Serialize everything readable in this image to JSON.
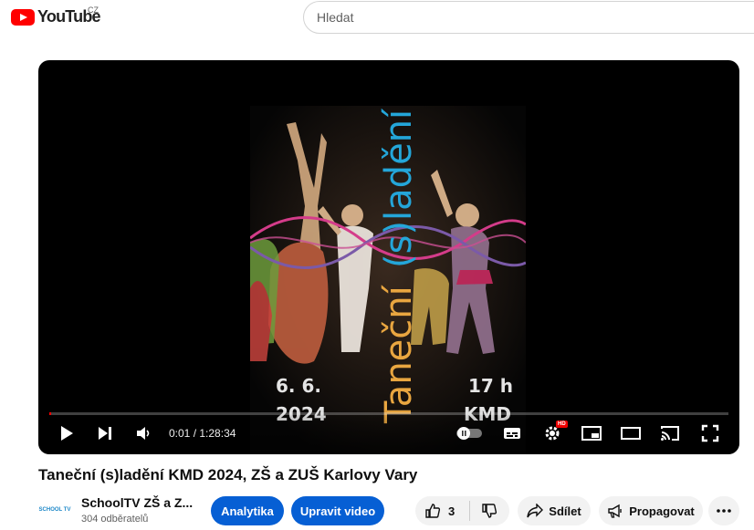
{
  "header": {
    "logo_text": "YouTube",
    "country_code": "CZ",
    "search_placeholder": "Hledat"
  },
  "poster": {
    "title_part1": "Taneční",
    "title_part2": "(s)ladění",
    "date_day": "6. 6.",
    "date_year": "2024",
    "time": "17 h",
    "venue": "KMD"
  },
  "player": {
    "current_time": "0:01",
    "separator": " / ",
    "duration": "1:28:34",
    "progress_fraction": 0.0002,
    "hd_badge": "HD"
  },
  "video": {
    "title": "Taneční (s)ladění KMD 2024, ZŠ a ZUŠ Karlovy Vary"
  },
  "channel": {
    "name": "SchoolTV ZŠ a Z...",
    "subscribers": "304 odběratelů",
    "avatar_text": "SCHOOL TV"
  },
  "actions": {
    "analytics_label": "Analytika",
    "edit_label": "Upravit video",
    "like_count": "3",
    "share_label": "Sdílet",
    "promote_label": "Propagovat"
  },
  "colors": {
    "brand_red": "#ff0000",
    "primary_blue": "#065fd4",
    "pill_grey": "#f2f2f2"
  }
}
